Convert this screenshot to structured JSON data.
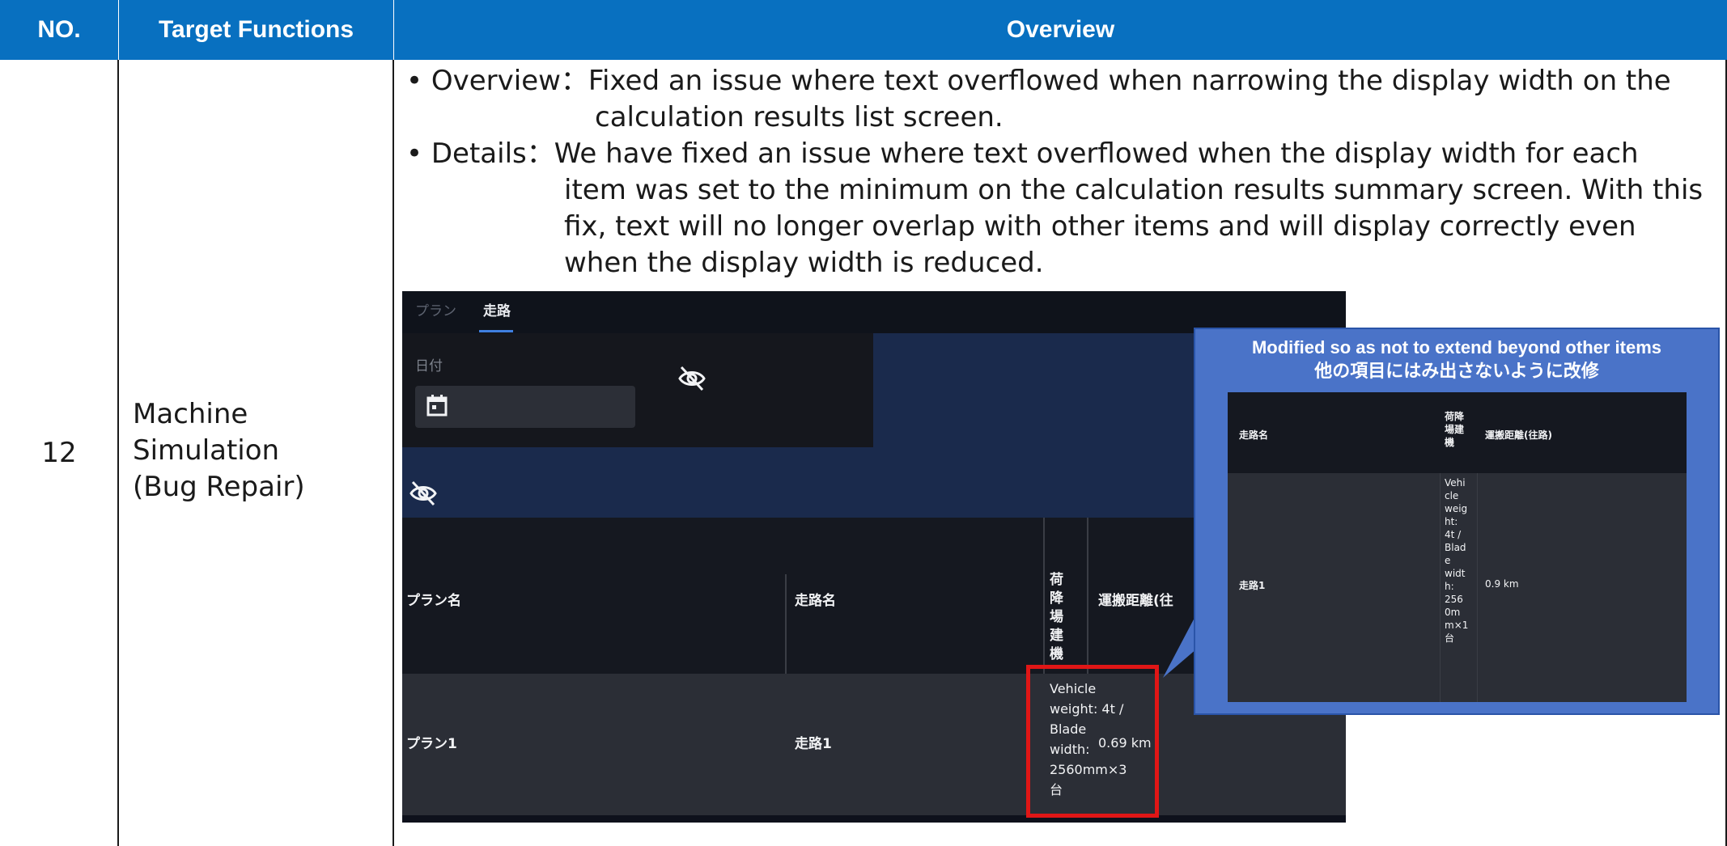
{
  "table": {
    "headers": {
      "no": "NO.",
      "functions": "Target Functions",
      "overview": "Overview"
    },
    "row": {
      "no": "12",
      "function_lines": [
        "Machine",
        "Simulation",
        "(Bug Repair)"
      ],
      "overview_lines": [
        "• Overview：Fixed an issue where text overflowed when narrowing the display width on the",
        "calculation results list screen.",
        "• Details：We have fixed an issue where text overflowed when the display width for each",
        "item was set to the minimum on the calculation results summary screen. With this",
        "fix, text will no longer overlap with other items and will display correctly even",
        "when the display width is reduced."
      ]
    }
  },
  "screenshot": {
    "tabs": [
      "プラン",
      "走路"
    ],
    "active_tab": "走路",
    "date_label": "日付",
    "columns": [
      "プラン名",
      "走路名",
      "荷降場建機",
      "運搬距離(往路)"
    ],
    "column3_lines": [
      "荷降",
      "場建",
      "機"
    ],
    "column4_label": "運搬距離(往",
    "row": {
      "plan": "プラン1",
      "route": "走路1",
      "vehicle": "Vehicle\nweight: 4t /\nBlade\nwidth:\n2560mm×3\n台",
      "distance": "0.69 km"
    },
    "icons": [
      "calendar-icon",
      "eye-off-icon"
    ]
  },
  "callout": {
    "title_en": "Modified so as not to extend beyond other items",
    "title_ja": "他の項目にはみ出さないように改修",
    "columns": [
      "走路名",
      "荷降場建機",
      "運搬距離(往路)"
    ],
    "col2_lines": [
      "荷降",
      "場建",
      "機"
    ],
    "row": {
      "route": "走路1",
      "vehicle": "Vehi\ncle\nweig\nht:\n4t /\nBlad\ne\nwidt\nh:\n256\n0m\nm×1\n台",
      "distance": "0.9 km"
    }
  },
  "colors": {
    "header_bg": "#0870C0",
    "highlight": "#e01616",
    "callout_bg": "#4a73c8"
  }
}
